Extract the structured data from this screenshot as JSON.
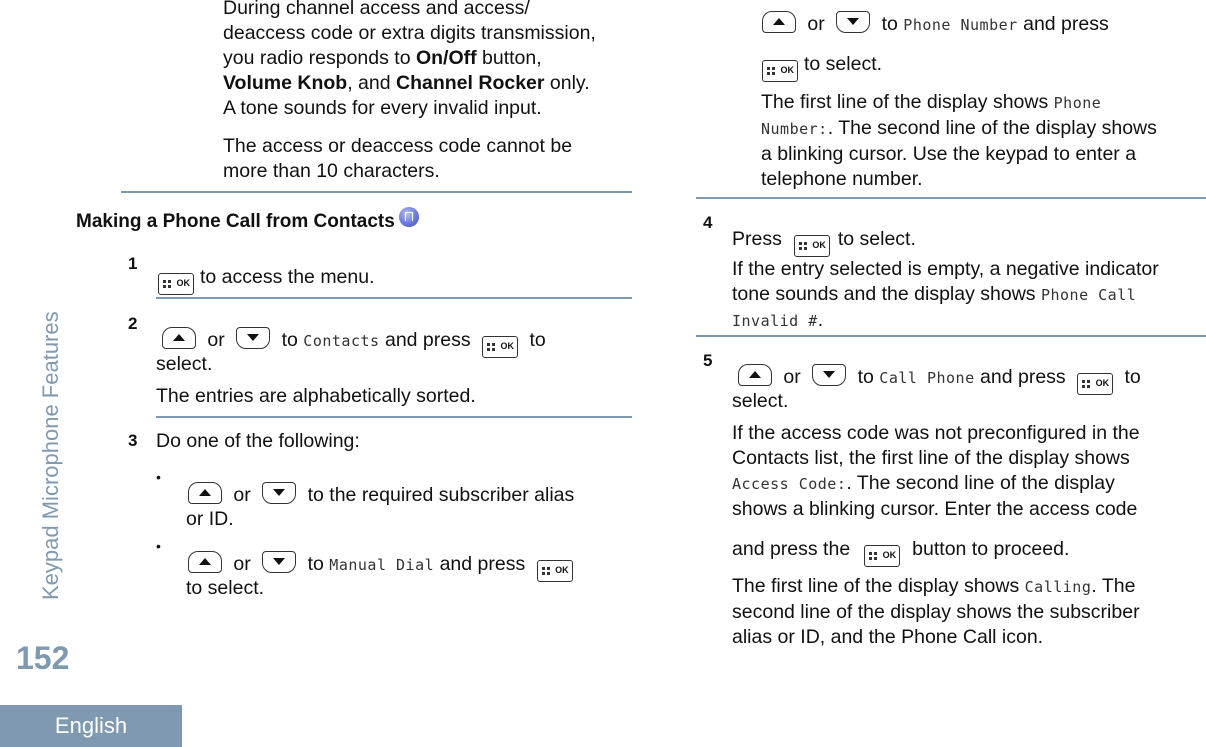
{
  "sidebar": {
    "section_title": "Keypad Microphone Features",
    "page_number": "152",
    "language_tab": "English"
  },
  "left": {
    "note": {
      "line1": "During channel access and access/",
      "line2": "deaccess code or extra digits transmission,",
      "line3_pre": "you radio responds to ",
      "line3_bold": "On/Off",
      "line3_post": " button,",
      "line4_bold1": "Volume Knob",
      "line4_mid": ", and ",
      "line4_bold2": "Channel Rocker",
      "line4_post": " only.",
      "line5": "A tone sounds for every invalid input.",
      "para2_line1": "The access or deaccess code cannot be",
      "para2_line2": "more than 10 characters."
    },
    "heading": "Making a Phone Call from Contacts",
    "steps": [
      {
        "number": "1",
        "text": "to access the menu."
      },
      {
        "number": "2",
        "or": "or",
        "to": "to",
        "display": "Contacts",
        "and_press": "and press",
        "to_select_a": "to",
        "to_select_b": "select.",
        "info": "The entries are alphabetically sorted."
      },
      {
        "number": "3",
        "text": "Do one of the following:",
        "options": [
          {
            "or": "or",
            "text_a": "to the required subscriber alias",
            "text_b": "or ID."
          },
          {
            "or": "or",
            "to": "to",
            "display": "Manual Dial",
            "and_press": "and press",
            "text_b": "to select."
          }
        ]
      }
    ]
  },
  "right": {
    "continued": {
      "or": "or",
      "to": "to",
      "display": "Phone Number",
      "and_press": "and press",
      "to_select": "to select.",
      "info_pre": "The first line of the display shows ",
      "info_display1": "Phone",
      "info_display2": "Number:",
      "info_post1": ". The second line of the display shows",
      "info_line3": "a blinking cursor. Use the keypad to enter a",
      "info_line4": "telephone number."
    },
    "steps": [
      {
        "number": "4",
        "press": "Press",
        "to_select": "to select.",
        "info_line1": "If the entry selected is empty, a negative indicator",
        "info_line2_pre": "tone sounds and the display shows ",
        "info_display1": "Phone Call",
        "info_display2": "Invalid #",
        "info_end": "."
      },
      {
        "number": "5",
        "or": "or",
        "to": "to",
        "display": "Call Phone",
        "and_press": "and press",
        "to_a": "to",
        "to_b": "select.",
        "info_line1": "If the access code was not preconfigured in the",
        "info_line2": "Contacts list, the first line of the display shows",
        "info_display": "Access Code:",
        "info_line3_post": ". The second line of the display",
        "info_line4": "shows a blinking cursor. Enter the access code",
        "info_line5_pre": "and press the",
        "info_line5_post": "button to proceed.",
        "result_pre": "The first line of the display shows ",
        "result_display": "Calling",
        "result_post": ". The",
        "result_line2": "second line of the display shows the subscriber",
        "result_line3": "alias or ID, and the Phone Call icon."
      }
    ]
  }
}
